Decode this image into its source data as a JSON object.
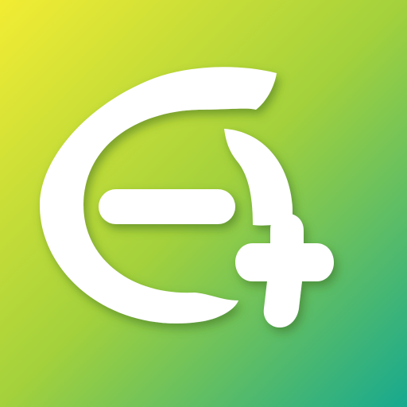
{
  "icon": {
    "name": "app-logo-icon",
    "colors": {
      "gradient_top_left": "#F2EC33",
      "gradient_mid": "#A3D13C",
      "gradient_bottom_right": "#17A98F",
      "glyph": "#FFFFFF",
      "shadow": "#3B6B1F"
    }
  }
}
